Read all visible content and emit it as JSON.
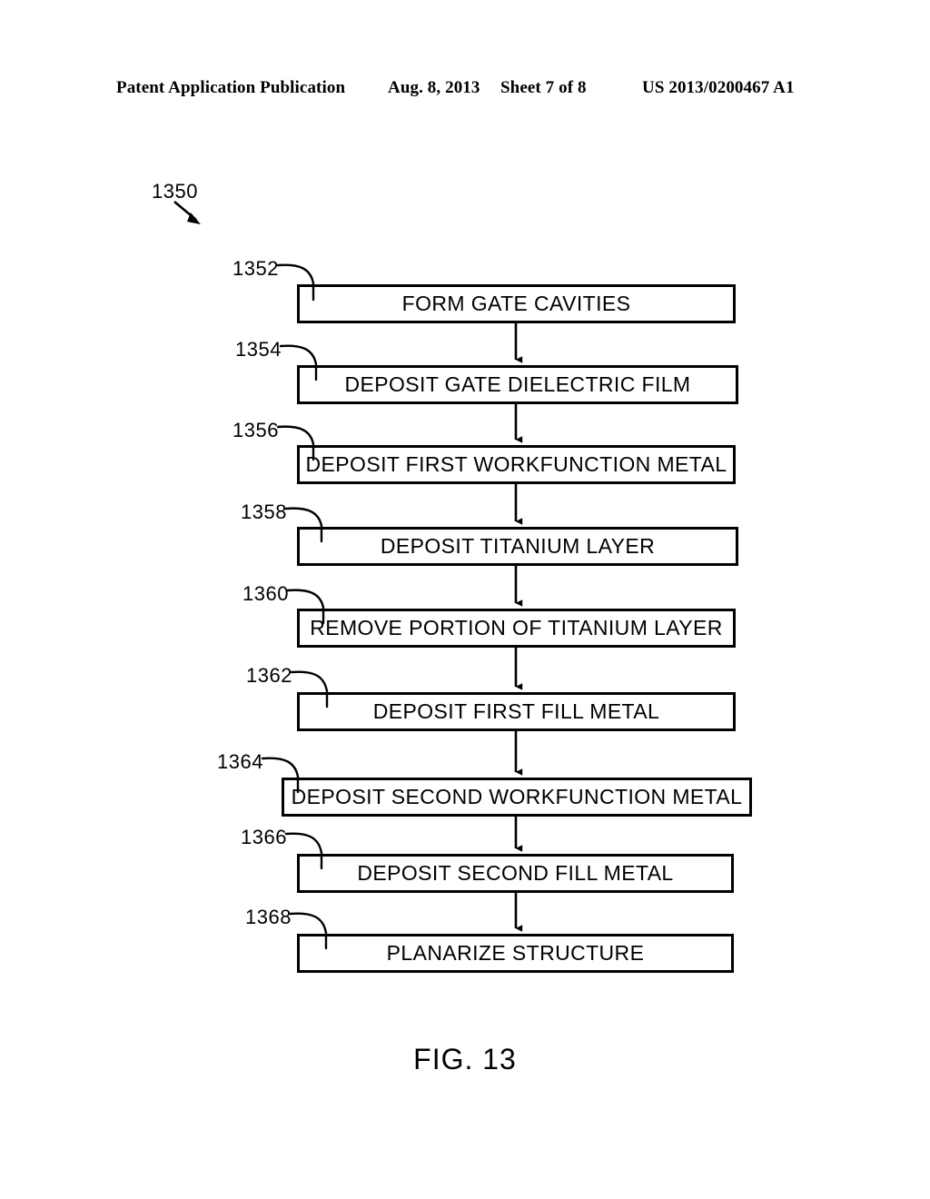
{
  "header": {
    "publication": "Patent Application Publication",
    "date": "Aug. 8, 2013",
    "sheet": "Sheet 7 of 8",
    "patent_number": "US 2013/0200467 A1"
  },
  "figure": {
    "caption": "FIG. 13",
    "diagram_reference": "1350",
    "ink_color": "#000000",
    "background_color": "#ffffff"
  },
  "flowchart": {
    "type": "process-flow",
    "orientation": "vertical",
    "steps": [
      {
        "ref": "1352",
        "label": "FORM GATE CAVITIES"
      },
      {
        "ref": "1354",
        "label": "DEPOSIT GATE DIELECTRIC FILM"
      },
      {
        "ref": "1356",
        "label": "DEPOSIT FIRST WORKFUNCTION METAL"
      },
      {
        "ref": "1358",
        "label": "DEPOSIT TITANIUM LAYER"
      },
      {
        "ref": "1360",
        "label": "REMOVE PORTION OF TITANIUM LAYER"
      },
      {
        "ref": "1362",
        "label": "DEPOSIT FIRST FILL METAL"
      },
      {
        "ref": "1364",
        "label": "DEPOSIT SECOND WORKFUNCTION METAL"
      },
      {
        "ref": "1366",
        "label": "DEPOSIT SECOND FILL METAL"
      },
      {
        "ref": "1368",
        "label": "PLANARIZE STRUCTURE"
      }
    ]
  }
}
